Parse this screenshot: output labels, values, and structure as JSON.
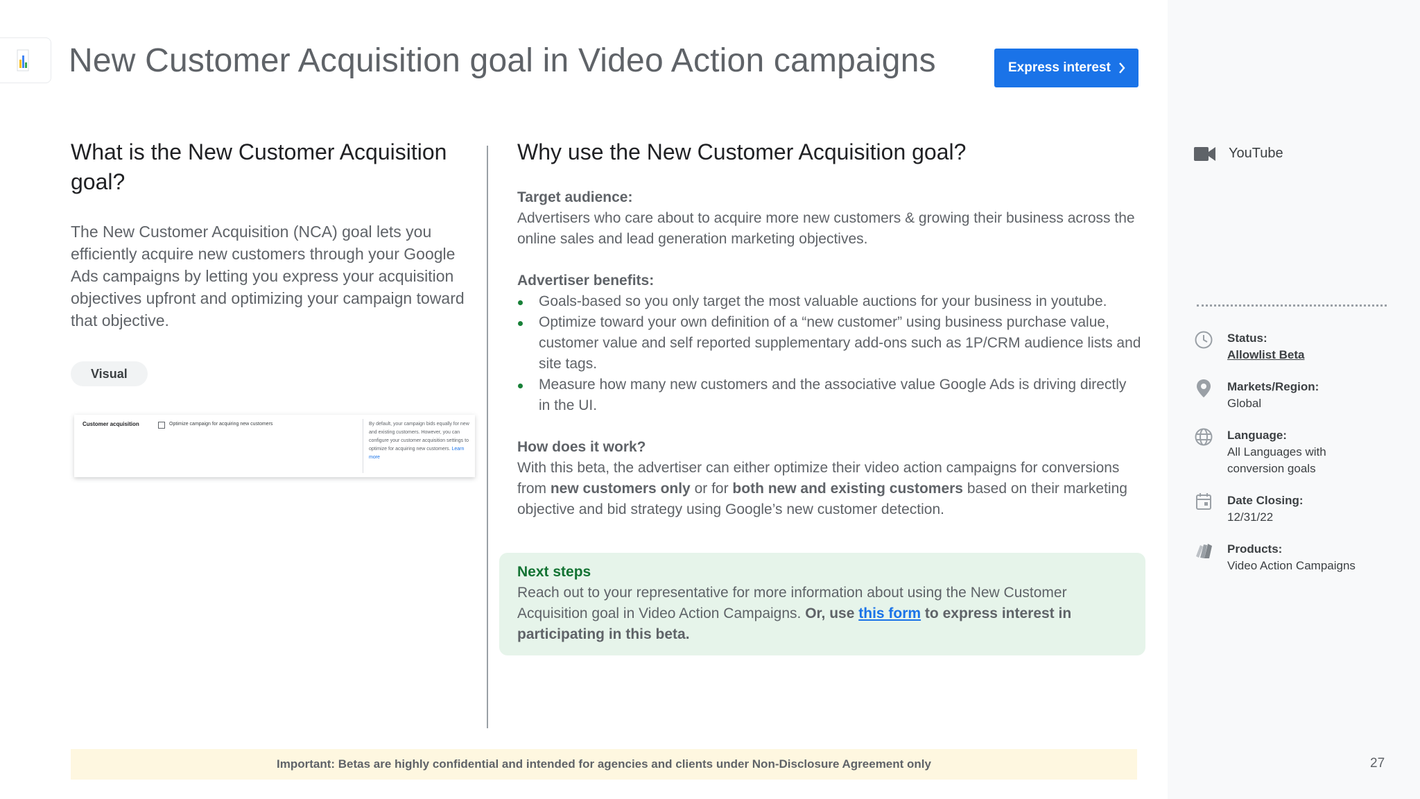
{
  "header": {
    "title": "New Customer Acquisition goal in Video Action campaigns",
    "cta_label": "Express interest"
  },
  "left": {
    "heading": "What is the New Customer Acquisition goal?",
    "paragraph": "The New Customer Acquisition (NCA) goal lets you efficiently acquire new customers through your Google Ads campaigns by letting you express your acquisition objectives upfront and optimizing your campaign toward that objective.",
    "pill": "Visual",
    "visual": {
      "label": "Customer acquisition",
      "option": "Optimize campaign for acquiring new customers",
      "help": "By default, your campaign bids equally for new and existing customers. However, you can configure your customer acquisition settings to optimize for acquiring new customers.",
      "help_link": "Learn more"
    }
  },
  "right": {
    "heading": "Why use the New Customer Acquisition goal?",
    "target_title": "Target audience:",
    "target_text": "Advertisers who care about to acquire more new customers & growing their business across the online sales and lead generation marketing objectives.",
    "benefits_title": "Advertiser benefits:",
    "benefits": [
      "Goals-based so you only target the most valuable auctions for your business in youtube.",
      "Optimize toward your own definition of a “new customer” using business purchase value, customer value and self reported supplementary add-ons such as 1P/CRM audience lists and site tags.",
      "Measure how many new customers and the associative value Google Ads is driving directly in the UI."
    ],
    "how_title": "How does it work?",
    "how_1": "With this beta, the advertiser can either optimize their video action campaigns for conversions from ",
    "how_b1": "new customers only",
    "how_2": " or for ",
    "how_b2": "both new and existing customers",
    "how_3": " based on their marketing objective and bid strategy  using Google’s new customer detection."
  },
  "next_steps": {
    "title": "Next steps",
    "text": "Reach out to your representative for more information about using the New Customer Acquisition goal in Video Action Campaigns. ",
    "bold_1": "Or, use ",
    "link": "this form",
    "bold_2": " to express interest in participating in this beta."
  },
  "notice": "Important: Betas are highly confidential and intended for agencies and clients under Non-Disclosure Agreement only",
  "page_number": "27",
  "sidebar": {
    "channel": "YouTube",
    "status_label": "Status:",
    "status_value": "Allowlist Beta",
    "markets_label": "Markets/Region:",
    "markets_value": "Global",
    "language_label": "Language:",
    "language_value": "All Languages with conversion goals",
    "date_label": "Date Closing:",
    "date_value": "12/31/22",
    "products_label": "Products:",
    "products_value": "Video Action Campaigns"
  },
  "icons": {
    "channel": "video-camera-icon",
    "status": "clock-icon",
    "markets": "location-pin-icon",
    "language": "globe-icon",
    "date": "calendar-icon",
    "products": "products-icon",
    "cta": "chevron-right-icon"
  },
  "colors": {
    "accent": "#1a73e8",
    "next_steps_bg": "#e6f4ea",
    "next_steps_title": "#137333",
    "notice_bg": "#fef7e0",
    "sidebar_bg": "#f8f9fa"
  }
}
